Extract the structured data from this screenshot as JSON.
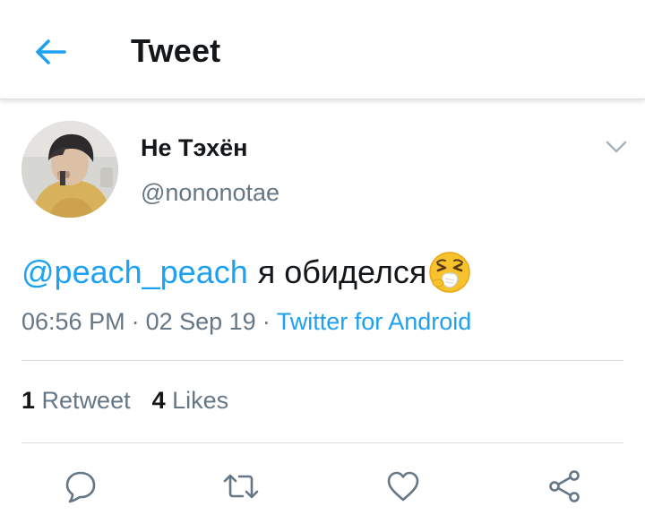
{
  "header": {
    "title": "Tweet",
    "back_icon": "arrow-left-icon",
    "accent_color": "#1da1f2"
  },
  "tweet": {
    "display_name": "Не Тэхён",
    "username": "@nononotae",
    "mention": "@peach_peach",
    "text": "я обиделся",
    "emoji": "sneezing-face-emoji",
    "time": "06:56 PM",
    "date": "02 Sep 19",
    "separator": "·",
    "source": "Twitter for Android"
  },
  "stats": {
    "retweets_count": "1",
    "retweets_label": "Retweet",
    "likes_count": "4",
    "likes_label": "Likes"
  },
  "actions": [
    "reply-icon",
    "retweet-icon",
    "like-icon",
    "share-icon"
  ],
  "colors": {
    "primary_text": "#14171a",
    "secondary_text": "#657786",
    "link": "#1da1f2",
    "divider": "#d7dbdf"
  }
}
